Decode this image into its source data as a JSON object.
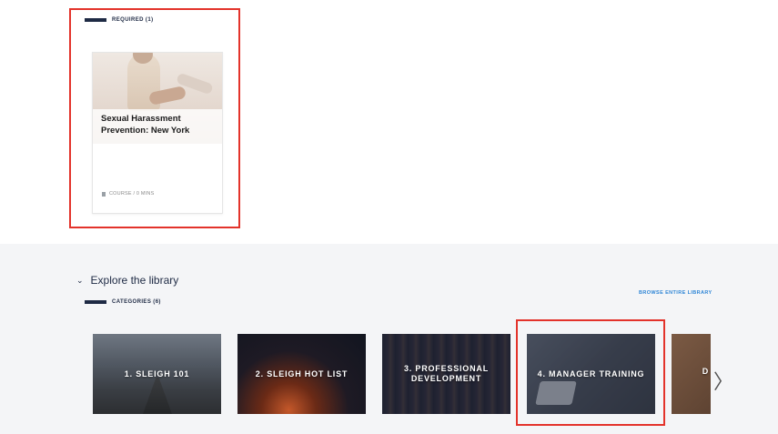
{
  "required_section": {
    "label": "REQUIRED (1)"
  },
  "course": {
    "title": "Sexual Harassment Prevention: New York",
    "meta": "COURSE / 0 MINS"
  },
  "library": {
    "heading": "Explore the library",
    "browse_link": "BROWSE ENTIRE LIBRARY",
    "categories_label": "CATEGORIES (6)",
    "categories": [
      {
        "label": "1. SLEIGH 101"
      },
      {
        "label": "2. SLEIGH HOT LIST"
      },
      {
        "label": "3. PROFESSIONAL DEVELOPMENT"
      },
      {
        "label": "4. MANAGER TRAINING"
      },
      {
        "label": "D"
      }
    ]
  },
  "colors": {
    "highlight": "#e3332b",
    "link": "#2f86d6",
    "navy": "#1e2a44"
  }
}
